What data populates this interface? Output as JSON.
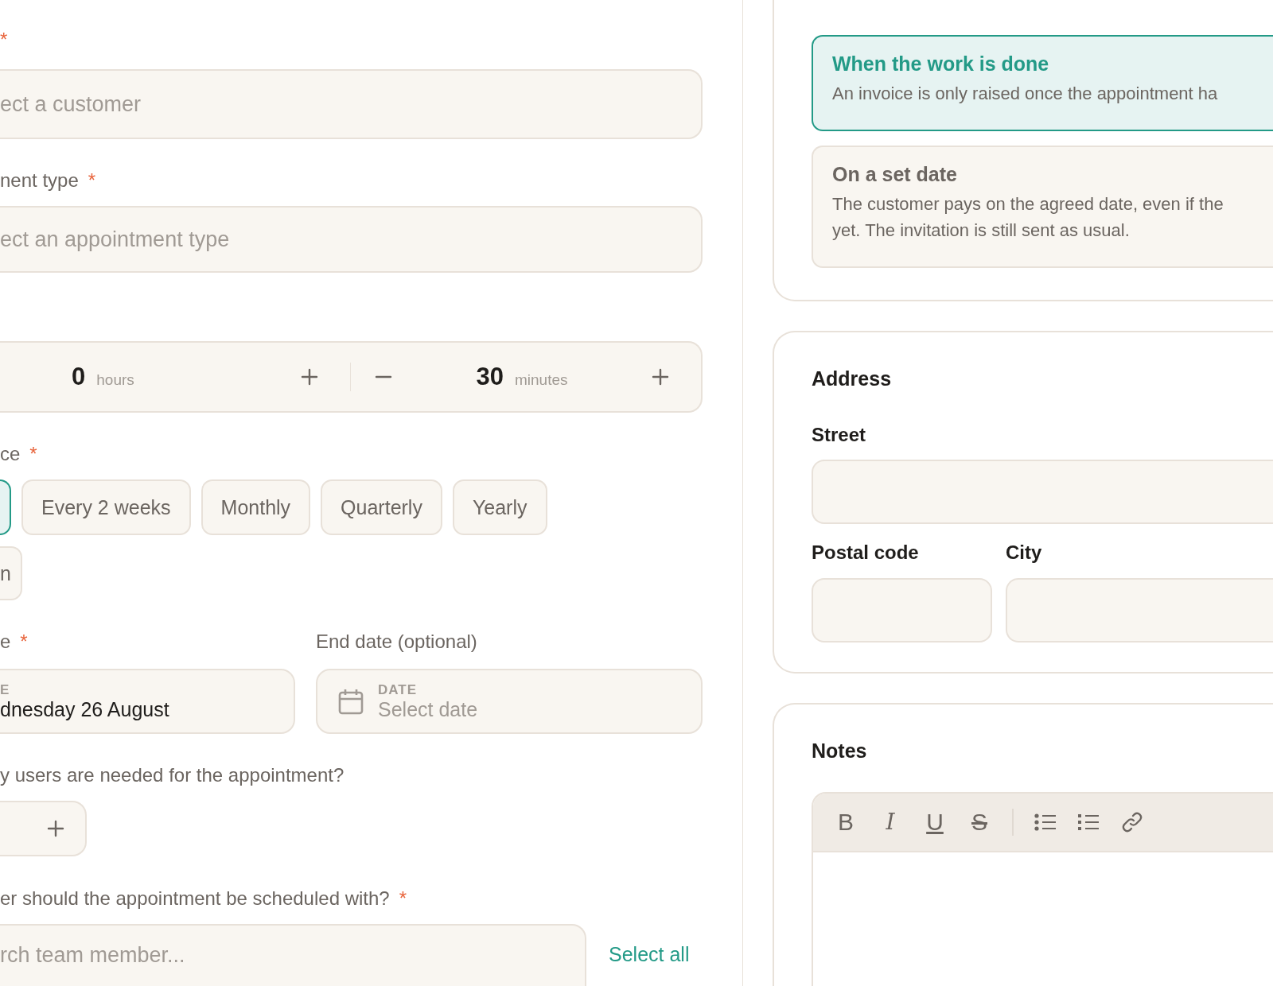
{
  "customer_field": {
    "label": {
      "required_mark": "*"
    },
    "placeholder": "ect a customer"
  },
  "appointment_type_field": {
    "label": {
      "text": "nent type",
      "required_mark": "*"
    },
    "placeholder": "ect an appointment type"
  },
  "duration": {
    "hours": {
      "value": "0",
      "unit": "hours"
    },
    "minutes": {
      "value": "30",
      "unit": "minutes"
    }
  },
  "frequency": {
    "label": {
      "text": "ce",
      "required_mark": "*"
    },
    "option_rows": [
      [
        {
          "selected": true
        },
        {
          "label": "Every 2 weeks",
          "selected": false
        },
        {
          "label": "Monthly",
          "selected": false
        },
        {
          "label": "Quarterly",
          "selected": false
        },
        {
          "label": "Yearly",
          "selected": false
        }
      ],
      [
        {
          "label": "n",
          "selected": false
        }
      ]
    ]
  },
  "start_date": {
    "label": {
      "text": "e",
      "required_mark": "*"
    },
    "caption": "E",
    "value": "dnesday 26 August"
  },
  "end_date": {
    "label": {
      "text": "End date (optional)"
    },
    "caption": "DATE",
    "placeholder": "Select date"
  },
  "users_needed": {
    "label": {
      "text": "y users are needed for the appointment?"
    }
  },
  "team_member": {
    "label": {
      "text": "er should the appointment be scheduled with?",
      "required_mark": "*"
    },
    "placeholder": "rch team member...",
    "select_all": "Select all"
  },
  "invoice_timing": {
    "options": [
      {
        "title": "When the work is done",
        "description_lines": [
          "An invoice is only raised once the appointment ha"
        ],
        "selected": true
      },
      {
        "title": "On a set date",
        "description_lines": [
          "The customer pays on the agreed date, even if the",
          "yet. The invitation is still sent as usual."
        ],
        "selected": false
      }
    ]
  },
  "address": {
    "title": "Address",
    "street": {
      "label": "Street"
    },
    "postal_code": {
      "label": "Postal code"
    },
    "city": {
      "label": "City"
    }
  },
  "notes": {
    "title": "Notes",
    "toolbar": [
      {
        "kind": "bold",
        "glyph": "B"
      },
      {
        "kind": "italic",
        "glyph": "I"
      },
      {
        "kind": "underline",
        "glyph": "U"
      },
      {
        "kind": "strike",
        "glyph": "S"
      },
      {
        "kind": "divider"
      },
      {
        "kind": "bullets"
      },
      {
        "kind": "numbers"
      },
      {
        "kind": "link"
      }
    ]
  }
}
